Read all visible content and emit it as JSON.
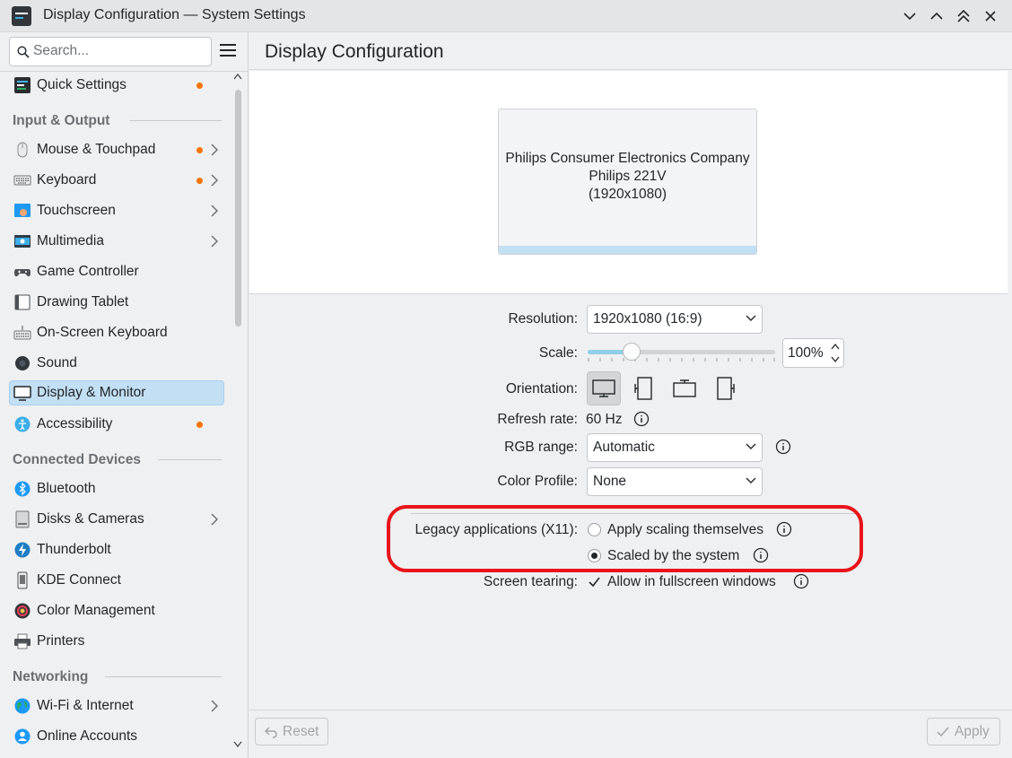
{
  "window": {
    "title": "Display Configuration — System Settings"
  },
  "sidebar": {
    "search_placeholder": "Search...",
    "top_item": {
      "label": "Quick Settings",
      "has_dot": true
    },
    "sections": [
      {
        "header": "Input & Output"
      },
      {
        "header": "Connected Devices"
      },
      {
        "header": "Networking"
      }
    ],
    "items": [
      {
        "label": "Mouse & Touchpad",
        "icon": "mouse-icon"
      },
      {
        "label": "Keyboard",
        "icon": "keyboard-icon"
      },
      {
        "label": "Touchscreen",
        "icon": "touchscreen-icon"
      },
      {
        "label": "Multimedia",
        "icon": "multimedia-icon"
      },
      {
        "label": "Game Controller",
        "icon": "gamepad-icon"
      },
      {
        "label": "Drawing Tablet",
        "icon": "tablet-icon"
      },
      {
        "label": "On-Screen Keyboard",
        "icon": "onscreen-keyboard-icon"
      },
      {
        "label": "Sound",
        "icon": "speaker-icon"
      },
      {
        "label": "Display & Monitor",
        "icon": "monitor-icon"
      },
      {
        "label": "Accessibility",
        "icon": "accessibility-icon"
      },
      {
        "label": "Bluetooth",
        "icon": "bluetooth-icon"
      },
      {
        "label": "Disks & Cameras",
        "icon": "disk-icon"
      },
      {
        "label": "Thunderbolt",
        "icon": "thunderbolt-icon"
      },
      {
        "label": "KDE Connect",
        "icon": "phone-icon"
      },
      {
        "label": "Color Management",
        "icon": "color-icon"
      },
      {
        "label": "Printers",
        "icon": "printer-icon"
      },
      {
        "label": "Wi-Fi & Internet",
        "icon": "globe-icon"
      },
      {
        "label": "Online Accounts",
        "icon": "accounts-icon"
      }
    ],
    "selected": "Display & Monitor"
  },
  "main": {
    "title": "Display Configuration",
    "monitor": {
      "manufacturer": "Philips Consumer Electronics Company",
      "model": "Philips 221V",
      "resolution": "(1920x1080)"
    },
    "form": {
      "resolution_label": "Resolution:",
      "resolution_value": "1920x1080 (16:9)",
      "scale_label": "Scale:",
      "scale_value": "100%",
      "scale_level": 0.25,
      "orientation_label": "Orientation:",
      "refresh_label": "Refresh rate:",
      "refresh_value": "60 Hz",
      "rgb_label": "RGB range:",
      "rgb_value": "Automatic",
      "color_profile_label": "Color Profile:",
      "color_profile_value": "None",
      "legacy_label": "Legacy applications (X11):",
      "legacy_option_1": "Apply scaling themselves",
      "legacy_option_2": "Scaled by the system",
      "tearing_label": "Screen tearing:",
      "tearing_option": "Allow in fullscreen windows"
    }
  },
  "footer": {
    "reset_label": "Reset",
    "apply_label": "Apply"
  },
  "colors": {
    "accent": "#3daee9",
    "selection": "#c2dff4",
    "highlight_ring": "#e8141a",
    "notify_dot": "#f67400"
  }
}
